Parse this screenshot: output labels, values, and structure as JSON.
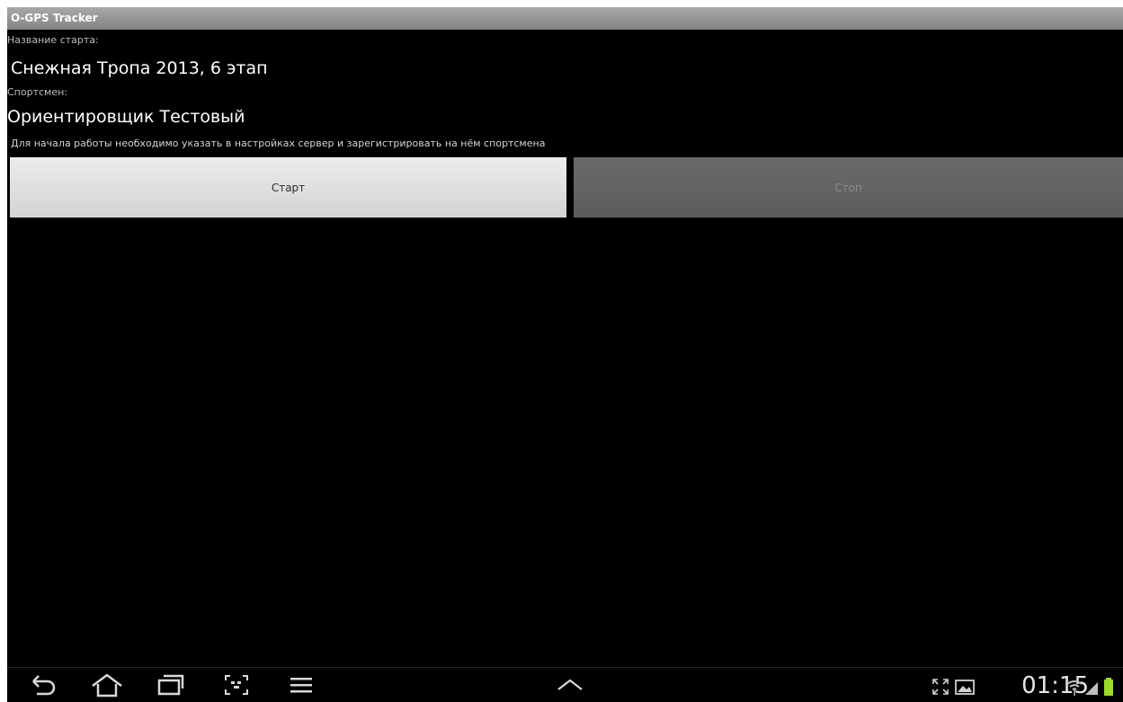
{
  "app": {
    "title": "O-GPS Tracker"
  },
  "form": {
    "start_name_label": "Название старта:",
    "start_name_value": "Снежная Тропа 2013, 6 этап",
    "athlete_label": "Спортсмен:",
    "athlete_value": "Ориентировщик Тестовый",
    "hint": "Для начала работы необходимо указать в настройках сервер и зарегистрировать на нём спортсмена"
  },
  "buttons": {
    "start_label": "Старт",
    "stop_label": "Стоп"
  },
  "navbar": {
    "icons": [
      "back-icon",
      "home-icon",
      "recent-apps-icon",
      "screenshot-icon",
      "menu-icon",
      "chevron-up-icon"
    ]
  },
  "status": {
    "time": "01:15",
    "icons": [
      "fullscreen-icon",
      "image-notification-icon",
      "wifi-icon",
      "signal-icon",
      "battery-icon"
    ],
    "battery_color": "#9bdc2b"
  }
}
